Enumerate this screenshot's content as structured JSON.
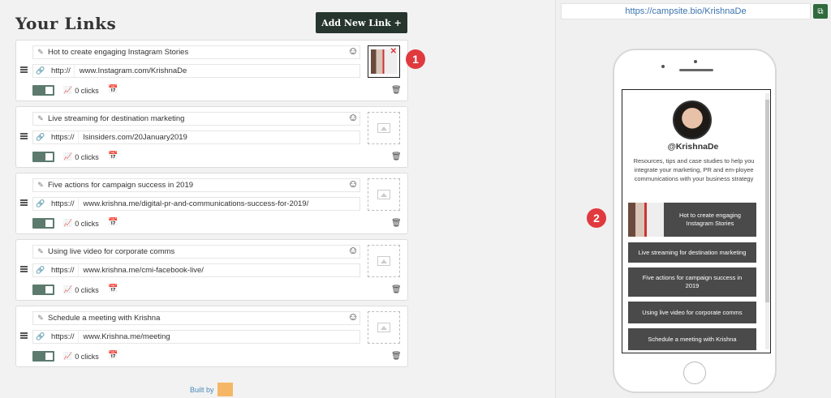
{
  "page": {
    "title": "Your Links",
    "add_button": "Add New Link +",
    "built_by": "Built by"
  },
  "links": [
    {
      "title": "Hot to create engaging Instagram Stories",
      "protocol": "http://",
      "url": "www.Instagram.com/KrishnaDe",
      "clicks": "0 clicks",
      "has_thumb": true
    },
    {
      "title": "Live streaming for destination marketing",
      "protocol": "https://",
      "url": "lsinsiders.com/20January2019",
      "clicks": "0 clicks",
      "has_thumb": false
    },
    {
      "title": "Five actions for campaign success in 2019",
      "protocol": "https://",
      "url": "www.krishna.me/digital-pr-and-communications-success-for-2019/",
      "clicks": "0 clicks",
      "has_thumb": false
    },
    {
      "title": "Using live video for corporate comms",
      "protocol": "https://",
      "url": "www.krishna.me/cmi-facebook-live/",
      "clicks": "0 clicks",
      "has_thumb": false
    },
    {
      "title": "Schedule a meeting with Krishna",
      "protocol": "https://",
      "url": "www.Krishna.me/meeting",
      "clicks": "0 clicks",
      "has_thumb": false
    }
  ],
  "badges": [
    "1",
    "2"
  ],
  "preview": {
    "url": "https://campsite.bio/KrishnaDe",
    "handle": "@KrishnaDe",
    "bio": "Resources, tips and case studies to help you integrate your marketing, PR and em-ployee communications with your business strategy",
    "links": [
      "Hot to create engaging Instagram Stories",
      "Live streaming for destination marketing",
      "Five actions for campaign success in 2019",
      "Using live video for corporate comms",
      "Schedule a meeting with Krishna"
    ]
  },
  "colors": {
    "accent": "#26352e",
    "toggle": "#5c7a6e",
    "badge": "#e0393e",
    "preview_button": "#4a4a4a",
    "link_blue": "#3a74b0"
  }
}
